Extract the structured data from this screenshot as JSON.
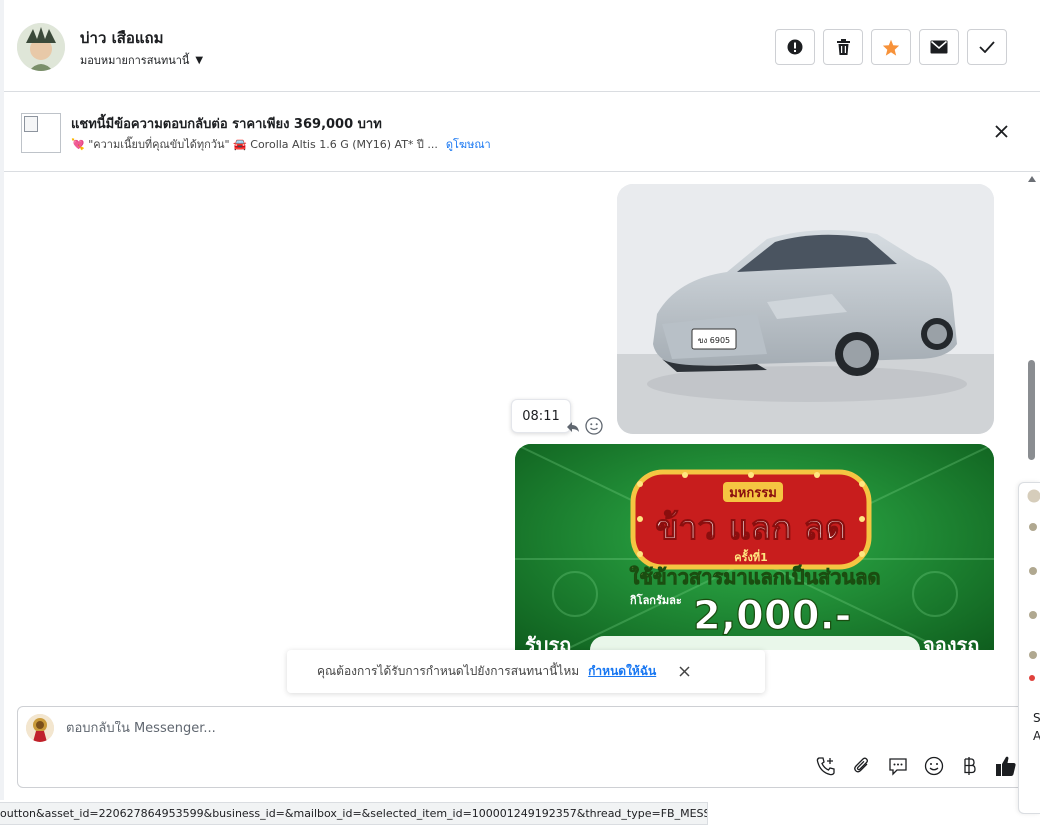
{
  "header": {
    "contact_name": "บ่าว เสือแถม",
    "assign_label": "มอบหมายการสนทนานี้",
    "actions": [
      {
        "name": "report",
        "icon": "alert-circle-icon"
      },
      {
        "name": "delete",
        "icon": "trash-icon"
      },
      {
        "name": "star",
        "icon": "star-icon"
      },
      {
        "name": "mark-unread",
        "icon": "envelope-icon"
      },
      {
        "name": "mark-done",
        "icon": "check-icon"
      }
    ]
  },
  "ad_banner": {
    "title": "แชทนี้มีข้อความตอบกลับต่อ ราคาเพียง 369,000 บาท",
    "subtitle": "💘 \"ความเนี๊ยบที่คุณขับได้ทุกวัน\" 🚘 Corolla Altis 1.6 G (MY16) AT* ปี ...",
    "link": "ดูโฆษณา"
  },
  "messages": {
    "car_image": {
      "plate": "ขง 6905"
    },
    "timestamp_tooltip": "08:11",
    "promo_image": {
      "line1": "มหกรรม",
      "line2": "ข้าว แลก ลด",
      "line3": "ครั้งที่1",
      "line4": "ใช้ข้าวสารมาแลกเป็นส่วนลด",
      "line5": "กิโลกรัมละ",
      "amount": "2,000.-",
      "left_text": "รับรถ",
      "right_text": "จองรถ"
    }
  },
  "toast": {
    "text": "คุณต้องการได้รับการกำหนดไปยังการสนทนานี้ไหม",
    "link": "กำหนดให้ฉัน"
  },
  "composer": {
    "placeholder": "ตอบกลับใน Messenger..."
  },
  "side_panel": {
    "text1": "S",
    "text2": "A"
  },
  "statusbar": {
    "url": "outton&asset_id=220627864953599&business_id=&mailbox_id=&selected_item_id=100001249192357&thread_type=FB_MESSAGE#"
  },
  "colors": {
    "accent": "#1877f2",
    "star": "#f7923a",
    "promo_green": "#1c8a2e",
    "promo_gold": "#f5c542"
  }
}
